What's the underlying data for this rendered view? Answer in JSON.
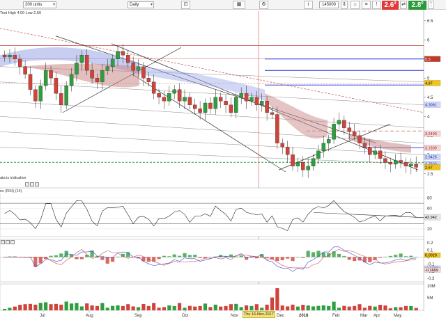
{
  "toolbar": {
    "units_select": "200 units",
    "interval_select": "Daily",
    "quantity": "145000",
    "sell_price": "2.6",
    "sell_price_sup": "3",
    "buy_price": "2.8",
    "buy_price_sup": "0",
    "sell_color": "#e03a3a",
    "buy_color": "#2a9a3a"
  },
  "main_chart": {
    "header": "Test High 4.00 Low 2.50",
    "note": "ata is indicative",
    "y_ticks": [
      "6.5",
      "6",
      "5.5",
      "5",
      "4.5",
      "4",
      "3.5",
      "3",
      "2.5"
    ],
    "price_tags": [
      {
        "label": "5.5",
        "color": "#c0392b",
        "text_color": "#ffffff",
        "value": 5.5
      },
      {
        "label": "4.87",
        "color": "#f0c419",
        "text_color": "#000000",
        "value": 4.87
      },
      {
        "label": "4.3061",
        "color": "#cfd8ff",
        "text_color": "#1a2a8a",
        "value": 4.3061
      },
      {
        "label": "3.5493",
        "color": "#f8d7d7",
        "text_color": "#a02020",
        "value": 3.5493
      },
      {
        "label": "3.1809",
        "color": "#f8d7d7",
        "text_color": "#a02020",
        "value": 3.1809
      },
      {
        "label": "2.9425",
        "color": "#cfd8ff",
        "text_color": "#1a2a8a",
        "value": 2.9425
      },
      {
        "label": "2.7633",
        "color": "#cfd8ff",
        "text_color": "#1a2a8a",
        "value": 2.7633
      },
      {
        "label": "2.67",
        "color": "#f0c419",
        "text_color": "#000000",
        "value": 2.67
      }
    ]
  },
  "rsi_panel": {
    "title": "ex (RSI) (14)",
    "y_ticks": [
      "80",
      "60",
      "40",
      "20"
    ],
    "value_tag": "42.942"
  },
  "macd_panel": {
    "y_ticks": [
      "0.2",
      "0.1",
      "0",
      "-0.1",
      "-0.2",
      "-0.3"
    ],
    "value_tags": [
      "0.0020",
      "-0.1633",
      "-0.1669"
    ]
  },
  "volume_panel": {
    "y_ticks": [
      "10M",
      "5M"
    ]
  },
  "x_axis": {
    "labels": [
      "Jul",
      "Aug",
      "Sep",
      "Oct",
      "Nov",
      "Dec",
      "2018",
      "Feb",
      "Mar",
      "Apr",
      "May"
    ],
    "crosshair_date": "Thu 16-Nov-2017"
  },
  "colors": {
    "bull": "#2e9e3e",
    "bear": "#d0433b",
    "cloud_bear": "#c98a8a",
    "cloud_bull": "#9aa6e6",
    "rsi_line": "#222222",
    "crosshair": "#e05050"
  },
  "chart_data": {
    "type": "candlestick",
    "y_ticks": [
      6.5,
      6,
      5.5,
      5,
      4.5,
      4,
      3.5,
      3,
      2.5
    ],
    "ylim": [
      2.35,
      6.75
    ],
    "x_labels": [
      "Jul",
      "Aug",
      "Sep",
      "Oct",
      "Nov",
      "Dec",
      "2018",
      "Feb",
      "Mar",
      "Apr",
      "May"
    ],
    "close_path": [
      5.55,
      5.6,
      5.5,
      5.3,
      5.1,
      4.7,
      4.4,
      4.8,
      5.2,
      5.0,
      4.6,
      4.3,
      4.8,
      5.1,
      5.4,
      5.6,
      5.2,
      5.0,
      4.9,
      5.2,
      5.3,
      5.5,
      5.7,
      5.6,
      5.4,
      5.2,
      5.3,
      5.0,
      4.9,
      4.6,
      4.5,
      4.4,
      4.6,
      4.7,
      4.4,
      4.5,
      4.3,
      4.2,
      4.1,
      4.35,
      4.2,
      4.5,
      4.4,
      4.3,
      4.1,
      4.5,
      4.6,
      4.4,
      4.5,
      4.3,
      4.4,
      4.1,
      4.05,
      3.3,
      3.2,
      3.0,
      2.7,
      2.8,
      2.6,
      2.7,
      2.9,
      3.1,
      3.3,
      3.4,
      3.8,
      3.9,
      3.7,
      3.6,
      3.5,
      3.3,
      3.2,
      3.0,
      3.1,
      2.9,
      2.8,
      2.75,
      2.85,
      2.8,
      2.7,
      2.75,
      2.67
    ]
  }
}
